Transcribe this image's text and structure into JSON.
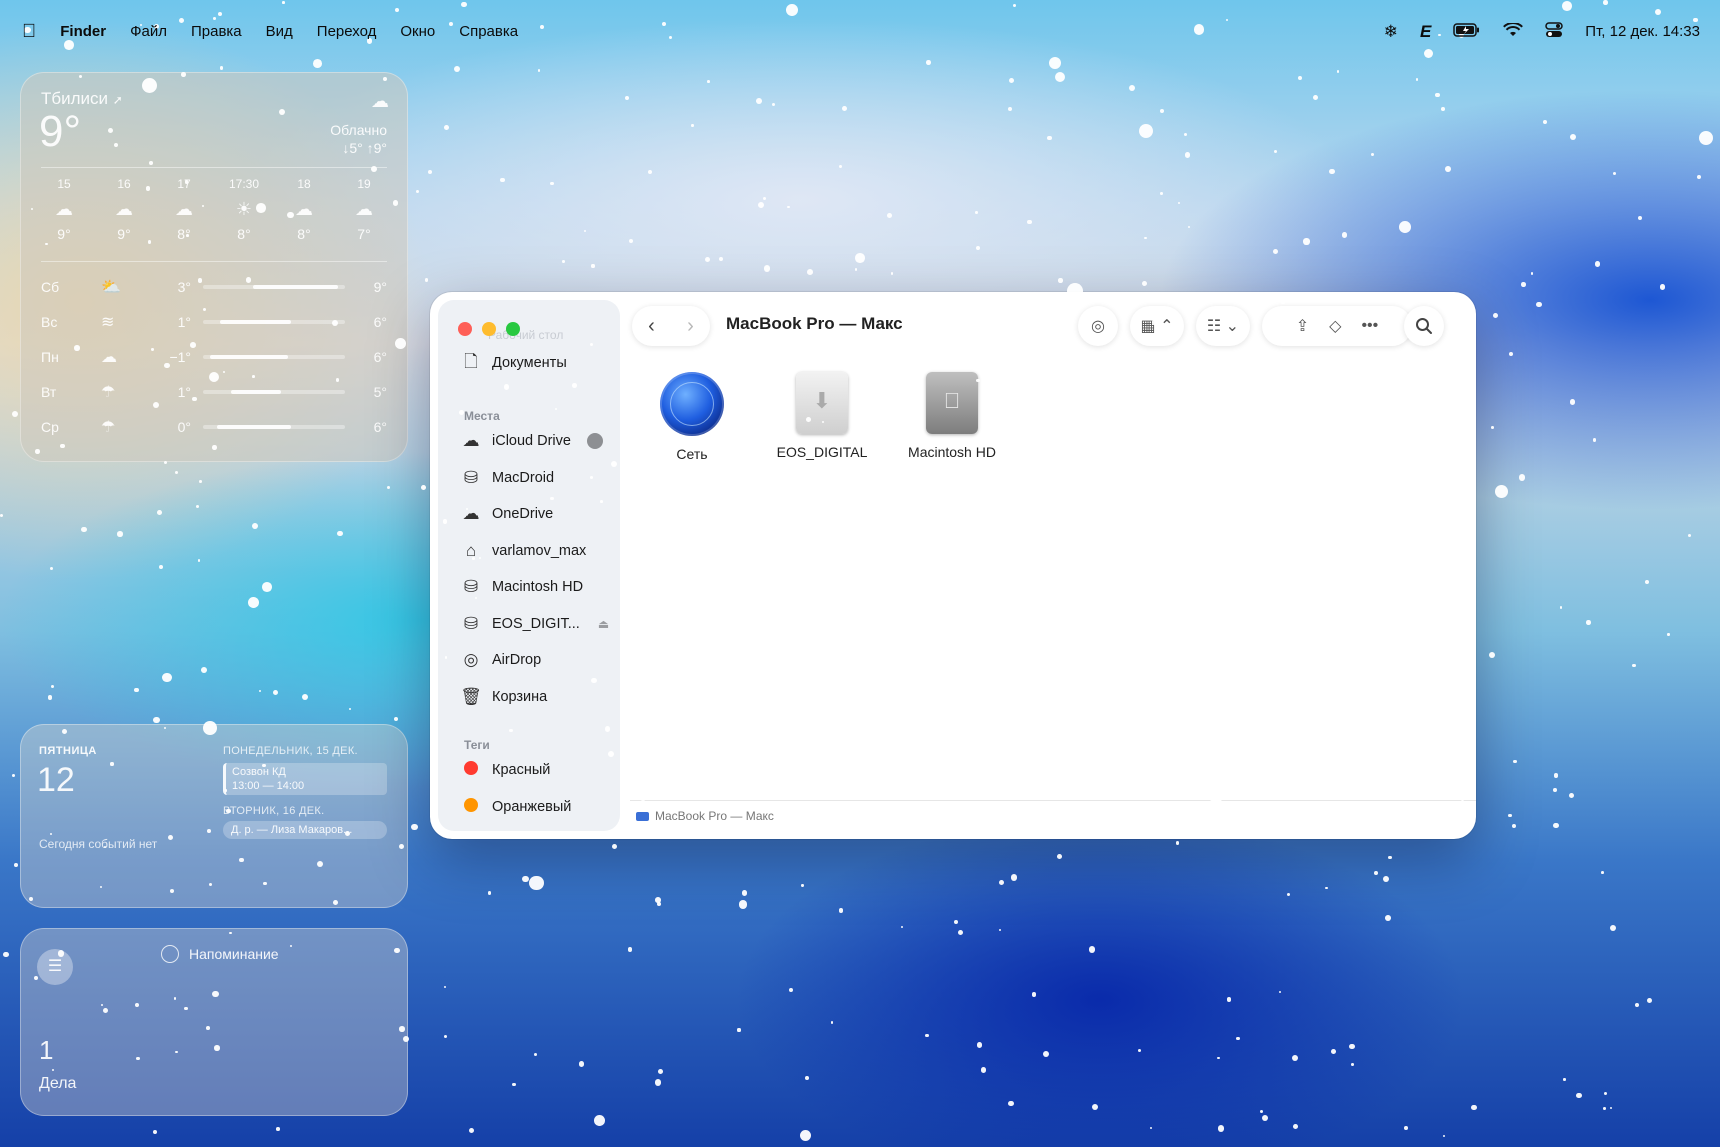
{
  "menubar": {
    "apple": "",
    "app": "Finder",
    "items": [
      "Файл",
      "Правка",
      "Вид",
      "Переход",
      "Окно",
      "Справка"
    ],
    "status_icons": [
      "snowflake-icon",
      "keyboard-layout-icon",
      "battery-icon",
      "wifi-icon",
      "control-center-icon"
    ],
    "layout_glyph": "E",
    "datetime": "Пт, 12 дек. 14:33"
  },
  "weather": {
    "city": "Тбилиси",
    "temp": "9°",
    "condition": "Облачно",
    "range": "↓5° ↑9°",
    "hours": [
      {
        "time": "15",
        "icon": "cloud-icon",
        "temp": "9°"
      },
      {
        "time": "16",
        "icon": "cloud-icon",
        "temp": "9°"
      },
      {
        "time": "17",
        "icon": "cloud-icon",
        "temp": "8°"
      },
      {
        "time": "17:30",
        "icon": "sunset-icon",
        "temp": "8°"
      },
      {
        "time": "18",
        "icon": "cloud-icon",
        "temp": "8°"
      },
      {
        "time": "19",
        "icon": "cloud-icon",
        "temp": "7°"
      }
    ],
    "days": [
      {
        "day": "Сб",
        "icon": "partly-sunny-icon",
        "lo": "3°",
        "hi": "9°",
        "bar_start": 0.35,
        "bar_end": 0.95
      },
      {
        "day": "Вс",
        "icon": "wind-icon",
        "lo": "1°",
        "hi": "6°",
        "bar_start": 0.12,
        "bar_end": 0.62
      },
      {
        "day": "Пн",
        "icon": "cloud-icon",
        "lo": "−1°",
        "hi": "6°",
        "bar_start": 0.05,
        "bar_end": 0.6
      },
      {
        "day": "Вт",
        "icon": "rain-icon",
        "lo": "1°",
        "hi": "5°",
        "bar_start": 0.2,
        "bar_end": 0.55
      },
      {
        "day": "Ср",
        "icon": "rain-icon",
        "lo": "0°",
        "hi": "6°",
        "bar_start": 0.1,
        "bar_end": 0.62
      }
    ]
  },
  "calendar": {
    "day_name": "ПЯТНИЦА",
    "day_num": "12",
    "no_events": "Сегодня событий нет",
    "h1": "ПОНЕДЕЛЬНИК, 15 ДЕК.",
    "event1_title": "Созвон КД",
    "event1_time": "13:00 — 14:00",
    "h2": "ВТОРНИК, 16 ДЕК.",
    "event2": "Д. р. — Лиза Макаров..."
  },
  "reminders": {
    "item": "Напоминание",
    "count": "1",
    "label": "Дела"
  },
  "finder": {
    "title": "MacBook Pro — Макс",
    "faded_top": "Рабочий стол",
    "favorites": [
      {
        "label": "Документы",
        "icon": "document-icon"
      }
    ],
    "places_header": "Места",
    "places": [
      {
        "label": "iCloud Drive",
        "icon": "cloud-icon"
      },
      {
        "label": "MacDroid",
        "icon": "drive-icon"
      },
      {
        "label": "OneDrive",
        "icon": "cloud-icon"
      },
      {
        "label": "varlamov_max",
        "icon": "home-icon"
      },
      {
        "label": "Macintosh HD",
        "icon": "drive-icon"
      },
      {
        "label": "EOS_DIGIT...",
        "icon": "drive-icon"
      },
      {
        "label": "AirDrop",
        "icon": "airdrop-icon"
      },
      {
        "label": "Корзина",
        "icon": "trash-icon"
      }
    ],
    "tags_header": "Теги",
    "tags": [
      {
        "label": "Красный",
        "color": "#ff3b30"
      },
      {
        "label": "Оранжевый",
        "color": "#ff9500"
      }
    ],
    "items": [
      {
        "label": "Сеть",
        "icon": "network-globe-icon"
      },
      {
        "label": "EOS_DIGITAL",
        "icon": "external-drive-icon"
      },
      {
        "label": "Macintosh HD",
        "icon": "internal-drive-icon"
      }
    ],
    "path": "MacBook Pro — Макс"
  }
}
